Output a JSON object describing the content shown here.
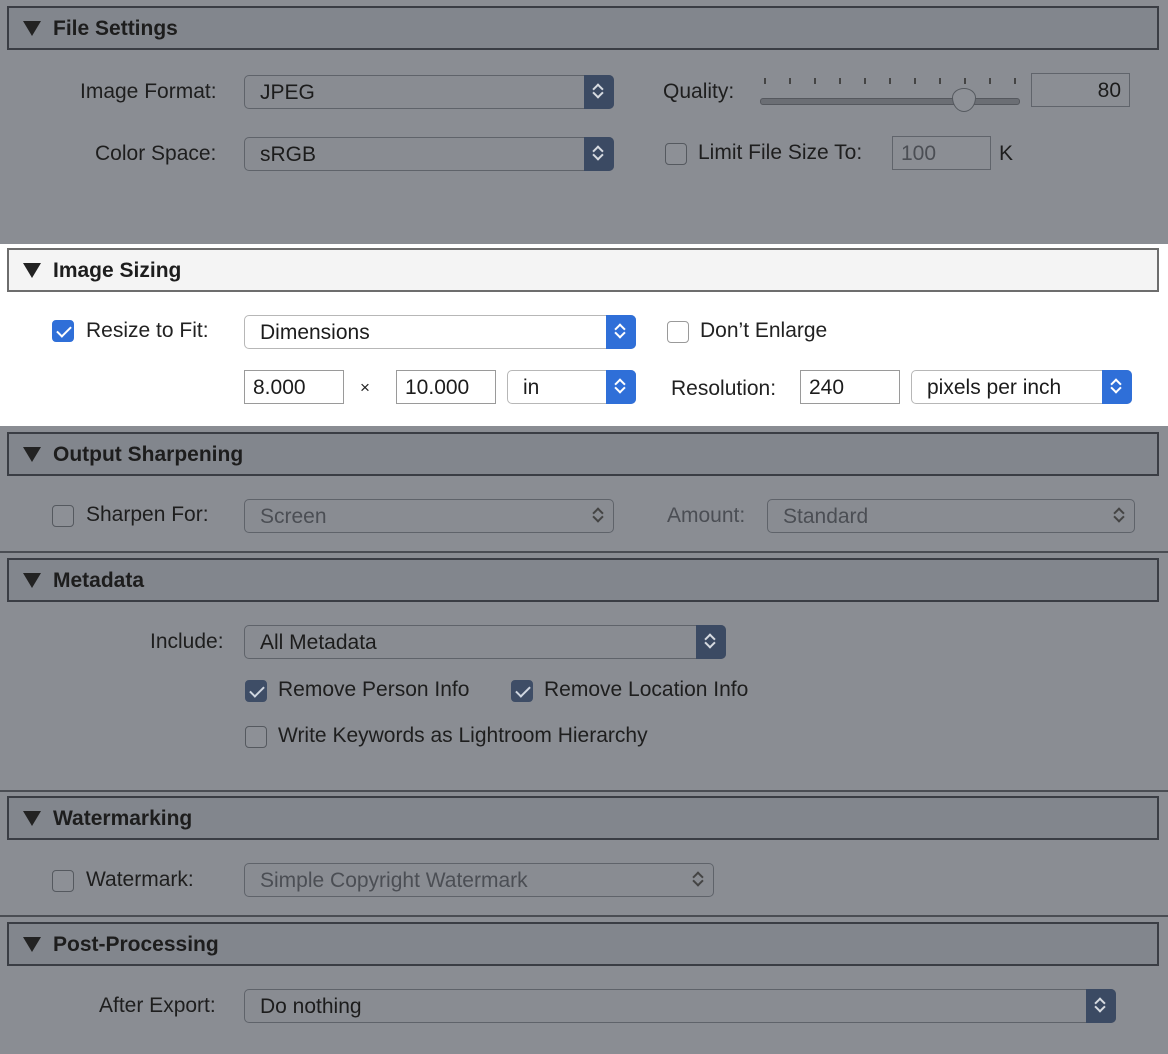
{
  "file_settings": {
    "title": "File Settings",
    "image_format_label": "Image Format:",
    "image_format_value": "JPEG",
    "color_space_label": "Color Space:",
    "color_space_value": "sRGB",
    "quality_label": "Quality:",
    "quality_value": "80",
    "quality_fraction": 0.8,
    "limit_size_label": "Limit File Size To:",
    "limit_size_checked": false,
    "limit_size_value": "100",
    "limit_size_unit": "K"
  },
  "image_sizing": {
    "title": "Image Sizing",
    "resize_label": "Resize to Fit:",
    "resize_checked": true,
    "resize_value": "Dimensions",
    "dont_enlarge_label": "Don’t Enlarge",
    "dont_enlarge_checked": false,
    "width_value": "8.000",
    "times": "×",
    "height_value": "10.000",
    "unit_value": "in",
    "resolution_label": "Resolution:",
    "resolution_value": "240",
    "resolution_unit_value": "pixels per inch"
  },
  "output_sharpening": {
    "title": "Output Sharpening",
    "sharpen_label": "Sharpen For:",
    "sharpen_checked": false,
    "sharpen_value": "Screen",
    "amount_label": "Amount:",
    "amount_value": "Standard"
  },
  "metadata": {
    "title": "Metadata",
    "include_label": "Include:",
    "include_value": "All Metadata",
    "remove_person_label": "Remove Person Info",
    "remove_person_checked": true,
    "remove_location_label": "Remove Location Info",
    "remove_location_checked": true,
    "write_keywords_label": "Write Keywords as Lightroom Hierarchy",
    "write_keywords_checked": false
  },
  "watermarking": {
    "title": "Watermarking",
    "watermark_label": "Watermark:",
    "watermark_checked": false,
    "watermark_value": "Simple Copyright Watermark"
  },
  "post_processing": {
    "title": "Post-Processing",
    "after_export_label": "After Export:",
    "after_export_value": "Do nothing"
  }
}
